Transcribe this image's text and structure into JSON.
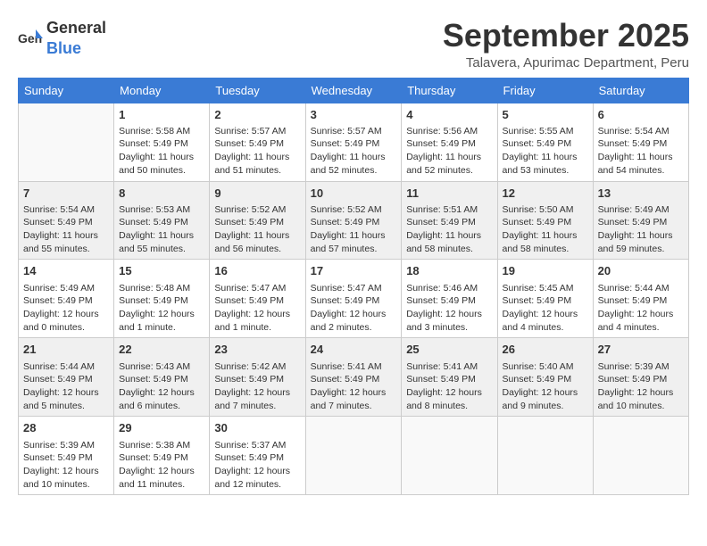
{
  "header": {
    "logo_general": "General",
    "logo_blue": "Blue",
    "month_title": "September 2025",
    "subtitle": "Talavera, Apurimac Department, Peru"
  },
  "weekdays": [
    "Sunday",
    "Monday",
    "Tuesday",
    "Wednesday",
    "Thursday",
    "Friday",
    "Saturday"
  ],
  "weeks": [
    [
      {
        "day": "",
        "sunrise": "",
        "sunset": "",
        "daylight": ""
      },
      {
        "day": "1",
        "sunrise": "Sunrise: 5:58 AM",
        "sunset": "Sunset: 5:49 PM",
        "daylight": "Daylight: 11 hours and 50 minutes."
      },
      {
        "day": "2",
        "sunrise": "Sunrise: 5:57 AM",
        "sunset": "Sunset: 5:49 PM",
        "daylight": "Daylight: 11 hours and 51 minutes."
      },
      {
        "day": "3",
        "sunrise": "Sunrise: 5:57 AM",
        "sunset": "Sunset: 5:49 PM",
        "daylight": "Daylight: 11 hours and 52 minutes."
      },
      {
        "day": "4",
        "sunrise": "Sunrise: 5:56 AM",
        "sunset": "Sunset: 5:49 PM",
        "daylight": "Daylight: 11 hours and 52 minutes."
      },
      {
        "day": "5",
        "sunrise": "Sunrise: 5:55 AM",
        "sunset": "Sunset: 5:49 PM",
        "daylight": "Daylight: 11 hours and 53 minutes."
      },
      {
        "day": "6",
        "sunrise": "Sunrise: 5:54 AM",
        "sunset": "Sunset: 5:49 PM",
        "daylight": "Daylight: 11 hours and 54 minutes."
      }
    ],
    [
      {
        "day": "7",
        "sunrise": "Sunrise: 5:54 AM",
        "sunset": "Sunset: 5:49 PM",
        "daylight": "Daylight: 11 hours and 55 minutes."
      },
      {
        "day": "8",
        "sunrise": "Sunrise: 5:53 AM",
        "sunset": "Sunset: 5:49 PM",
        "daylight": "Daylight: 11 hours and 55 minutes."
      },
      {
        "day": "9",
        "sunrise": "Sunrise: 5:52 AM",
        "sunset": "Sunset: 5:49 PM",
        "daylight": "Daylight: 11 hours and 56 minutes."
      },
      {
        "day": "10",
        "sunrise": "Sunrise: 5:52 AM",
        "sunset": "Sunset: 5:49 PM",
        "daylight": "Daylight: 11 hours and 57 minutes."
      },
      {
        "day": "11",
        "sunrise": "Sunrise: 5:51 AM",
        "sunset": "Sunset: 5:49 PM",
        "daylight": "Daylight: 11 hours and 58 minutes."
      },
      {
        "day": "12",
        "sunrise": "Sunrise: 5:50 AM",
        "sunset": "Sunset: 5:49 PM",
        "daylight": "Daylight: 11 hours and 58 minutes."
      },
      {
        "day": "13",
        "sunrise": "Sunrise: 5:49 AM",
        "sunset": "Sunset: 5:49 PM",
        "daylight": "Daylight: 11 hours and 59 minutes."
      }
    ],
    [
      {
        "day": "14",
        "sunrise": "Sunrise: 5:49 AM",
        "sunset": "Sunset: 5:49 PM",
        "daylight": "Daylight: 12 hours and 0 minutes."
      },
      {
        "day": "15",
        "sunrise": "Sunrise: 5:48 AM",
        "sunset": "Sunset: 5:49 PM",
        "daylight": "Daylight: 12 hours and 1 minute."
      },
      {
        "day": "16",
        "sunrise": "Sunrise: 5:47 AM",
        "sunset": "Sunset: 5:49 PM",
        "daylight": "Daylight: 12 hours and 1 minute."
      },
      {
        "day": "17",
        "sunrise": "Sunrise: 5:47 AM",
        "sunset": "Sunset: 5:49 PM",
        "daylight": "Daylight: 12 hours and 2 minutes."
      },
      {
        "day": "18",
        "sunrise": "Sunrise: 5:46 AM",
        "sunset": "Sunset: 5:49 PM",
        "daylight": "Daylight: 12 hours and 3 minutes."
      },
      {
        "day": "19",
        "sunrise": "Sunrise: 5:45 AM",
        "sunset": "Sunset: 5:49 PM",
        "daylight": "Daylight: 12 hours and 4 minutes."
      },
      {
        "day": "20",
        "sunrise": "Sunrise: 5:44 AM",
        "sunset": "Sunset: 5:49 PM",
        "daylight": "Daylight: 12 hours and 4 minutes."
      }
    ],
    [
      {
        "day": "21",
        "sunrise": "Sunrise: 5:44 AM",
        "sunset": "Sunset: 5:49 PM",
        "daylight": "Daylight: 12 hours and 5 minutes."
      },
      {
        "day": "22",
        "sunrise": "Sunrise: 5:43 AM",
        "sunset": "Sunset: 5:49 PM",
        "daylight": "Daylight: 12 hours and 6 minutes."
      },
      {
        "day": "23",
        "sunrise": "Sunrise: 5:42 AM",
        "sunset": "Sunset: 5:49 PM",
        "daylight": "Daylight: 12 hours and 7 minutes."
      },
      {
        "day": "24",
        "sunrise": "Sunrise: 5:41 AM",
        "sunset": "Sunset: 5:49 PM",
        "daylight": "Daylight: 12 hours and 7 minutes."
      },
      {
        "day": "25",
        "sunrise": "Sunrise: 5:41 AM",
        "sunset": "Sunset: 5:49 PM",
        "daylight": "Daylight: 12 hours and 8 minutes."
      },
      {
        "day": "26",
        "sunrise": "Sunrise: 5:40 AM",
        "sunset": "Sunset: 5:49 PM",
        "daylight": "Daylight: 12 hours and 9 minutes."
      },
      {
        "day": "27",
        "sunrise": "Sunrise: 5:39 AM",
        "sunset": "Sunset: 5:49 PM",
        "daylight": "Daylight: 12 hours and 10 minutes."
      }
    ],
    [
      {
        "day": "28",
        "sunrise": "Sunrise: 5:39 AM",
        "sunset": "Sunset: 5:49 PM",
        "daylight": "Daylight: 12 hours and 10 minutes."
      },
      {
        "day": "29",
        "sunrise": "Sunrise: 5:38 AM",
        "sunset": "Sunset: 5:49 PM",
        "daylight": "Daylight: 12 hours and 11 minutes."
      },
      {
        "day": "30",
        "sunrise": "Sunrise: 5:37 AM",
        "sunset": "Sunset: 5:49 PM",
        "daylight": "Daylight: 12 hours and 12 minutes."
      },
      {
        "day": "",
        "sunrise": "",
        "sunset": "",
        "daylight": ""
      },
      {
        "day": "",
        "sunrise": "",
        "sunset": "",
        "daylight": ""
      },
      {
        "day": "",
        "sunrise": "",
        "sunset": "",
        "daylight": ""
      },
      {
        "day": "",
        "sunrise": "",
        "sunset": "",
        "daylight": ""
      }
    ]
  ]
}
